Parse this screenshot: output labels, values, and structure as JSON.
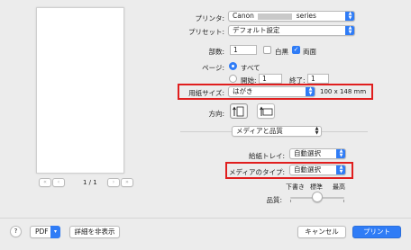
{
  "printer": {
    "label": "プリンタ:",
    "value_prefix": "Canon",
    "value_suffix": "series"
  },
  "preset": {
    "label": "プリセット:",
    "value": "デフォルト設定"
  },
  "copies": {
    "label": "部数:",
    "value": "1",
    "bw_label": "白黒",
    "bw_checked": false,
    "duplex_label": "両面",
    "duplex_checked": true
  },
  "pages": {
    "label": "ページ:",
    "all_label": "すべて",
    "from_label": "開始:",
    "from_value": "1",
    "to_label": "終了:",
    "to_value": "1"
  },
  "paper_size": {
    "label": "用紙サイズ:",
    "value": "はがき",
    "dimensions": "100 x 148 mm"
  },
  "orientation": {
    "label": "方向:"
  },
  "section": {
    "value": "メディアと品質"
  },
  "paper_tray": {
    "label": "給紙トレイ:",
    "value": "自動選択"
  },
  "media_type": {
    "label": "メディアのタイプ:",
    "value": "自動選択"
  },
  "quality": {
    "label": "品質:",
    "draft": "下書き",
    "standard": "標準",
    "high": "最高"
  },
  "preview": {
    "page_indicator": "1 / 1"
  },
  "footer": {
    "help": "?",
    "pdf": "PDF",
    "hide_details": "詳細を非表示",
    "cancel": "キャンセル",
    "print": "プリント"
  }
}
